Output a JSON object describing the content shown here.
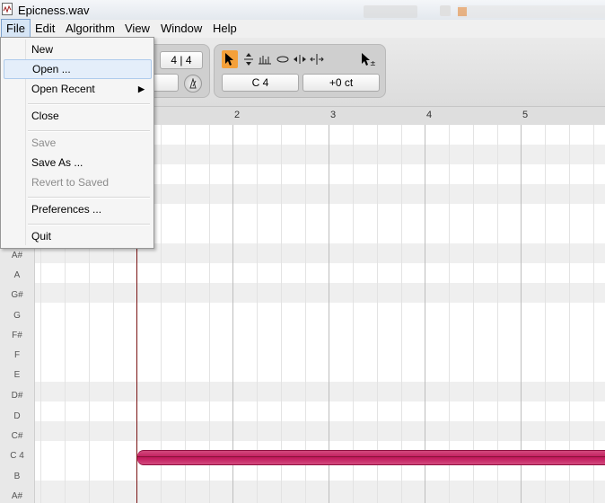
{
  "window": {
    "title": "Epicness.wav",
    "icon": "wav-file-icon"
  },
  "menubar": [
    "File",
    "Edit",
    "Algorithm",
    "View",
    "Window",
    "Help"
  ],
  "file_menu": {
    "new": "New",
    "open": "Open ...",
    "open_recent": "Open Recent",
    "close": "Close",
    "save": "Save",
    "save_as": "Save As ...",
    "revert": "Revert to Saved",
    "preferences": "Preferences ...",
    "quit": "Quit",
    "highlighted": "Open ...",
    "disabled": [
      "Save",
      "Revert to Saved"
    ]
  },
  "toolbar": {
    "time_signature": "4 | 4",
    "note": "C 4",
    "cents": "+0 ct",
    "tools": [
      "main-tool-icon",
      "pitch-tool-icon",
      "formant-tool-icon",
      "amplitude-tool-icon",
      "time-tool-icon",
      "separation-tool-icon",
      "edit-add-tool-icon"
    ],
    "active_tool": "main-tool-icon"
  },
  "ruler": {
    "bars": [
      "2",
      "3",
      "4",
      "5"
    ]
  },
  "piano_keys": [
    "A#",
    "A",
    "G#",
    "G",
    "F#",
    "F",
    "E",
    "D#",
    "D",
    "C#",
    "C 4",
    "B",
    "A#"
  ],
  "note_blob": {
    "pitch": "C 4",
    "color": "#c2185b"
  },
  "colors": {
    "active_tool": "#f4a03a",
    "blob": "#c2185b",
    "playhead": "#7a1414"
  }
}
